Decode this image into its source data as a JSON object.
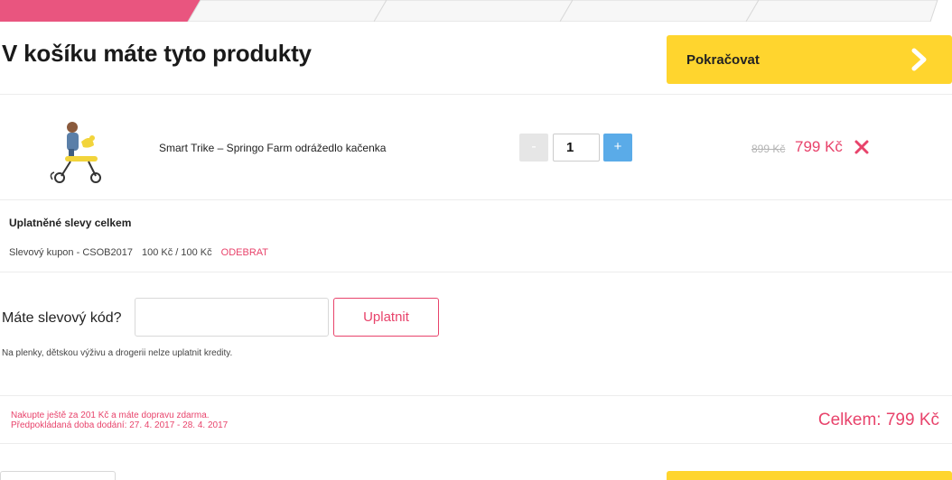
{
  "colors": {
    "accent_pink": "#e8436b",
    "cta_yellow": "#ffd52e",
    "plus_blue": "#5aabe8",
    "step_active": "#e9557f"
  },
  "page": {
    "title": "V košíku máte tyto produkty"
  },
  "cta": {
    "continue_label": "Pokračovat",
    "icon": "chevron-right-icon"
  },
  "cart": {
    "items": [
      {
        "name": "Smart Trike – Springo Farm odrážedlo kačenka",
        "quantity": "1",
        "minus_label": "-",
        "plus_label": "+",
        "old_price": "899 Kč",
        "price": "799 Kč",
        "remove_icon": "close-icon"
      }
    ]
  },
  "discounts": {
    "title": "Uplatněné slevy celkem",
    "items": [
      {
        "name": "Slevový kupon - CSOB2017",
        "amount": "100 Kč / 100 Kč",
        "remove_label": "ODEBRAT"
      }
    ]
  },
  "coupon": {
    "label": "Máte slevový kód?",
    "input_value": "",
    "apply_label": "Uplatnit",
    "note": "Na plenky, dětskou výživu a drogerii nelze uplatnit kredity."
  },
  "summary": {
    "free_shipping_note": "Nakupte ještě za 201 Kč a máte dopravu zdarma.",
    "delivery_estimate": "Předpokládaná doba dodání: 27. 4. 2017 - 28. 4. 2017",
    "total": "Celkem: 799 Kč"
  }
}
